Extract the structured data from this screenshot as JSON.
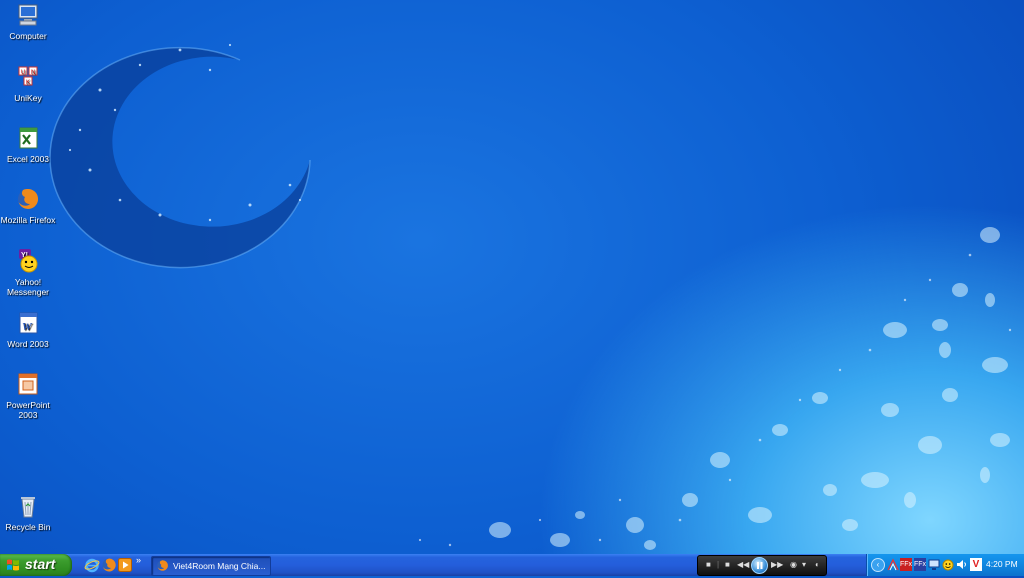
{
  "desktop": {
    "icons": [
      {
        "label": "Computer",
        "icon": "computer-icon"
      },
      {
        "label": "UniKey",
        "icon": "unikey-icon"
      },
      {
        "label": "Excel 2003",
        "icon": "excel-icon"
      },
      {
        "label": "Mozilla Firefox",
        "icon": "firefox-icon"
      },
      {
        "label": "Yahoo! Messenger",
        "icon": "yahoo-messenger-icon"
      },
      {
        "label": "Word 2003",
        "icon": "word-icon"
      },
      {
        "label": "PowerPoint 2003",
        "icon": "powerpoint-icon"
      },
      {
        "label": "Recycle Bin",
        "icon": "recycle-bin-icon"
      }
    ]
  },
  "taskbar": {
    "start_label": "start",
    "quick_launch": [
      "internet-explorer-icon",
      "firefox-icon",
      "media-player-icon"
    ],
    "quick_launch_more": "»",
    "tasks": [
      {
        "label": "Viet4Room Mạng Chia...",
        "icon": "firefox-icon",
        "active": true
      }
    ],
    "media_controls": [
      "stop",
      "previous",
      "play-pause",
      "next",
      "volume"
    ],
    "tray_icons": [
      "network-icon",
      "ffx-icon",
      "ffx-icon-2",
      "display-icon",
      "messenger-tray-icon",
      "volume-icon",
      "antivirus-icon"
    ],
    "clock": "4:20 PM"
  },
  "colors": {
    "desktop_bg": "#0d5fd1",
    "taskbar": "#245edb",
    "start_button": "#3c9d2e",
    "tray": "#0f86e0"
  }
}
